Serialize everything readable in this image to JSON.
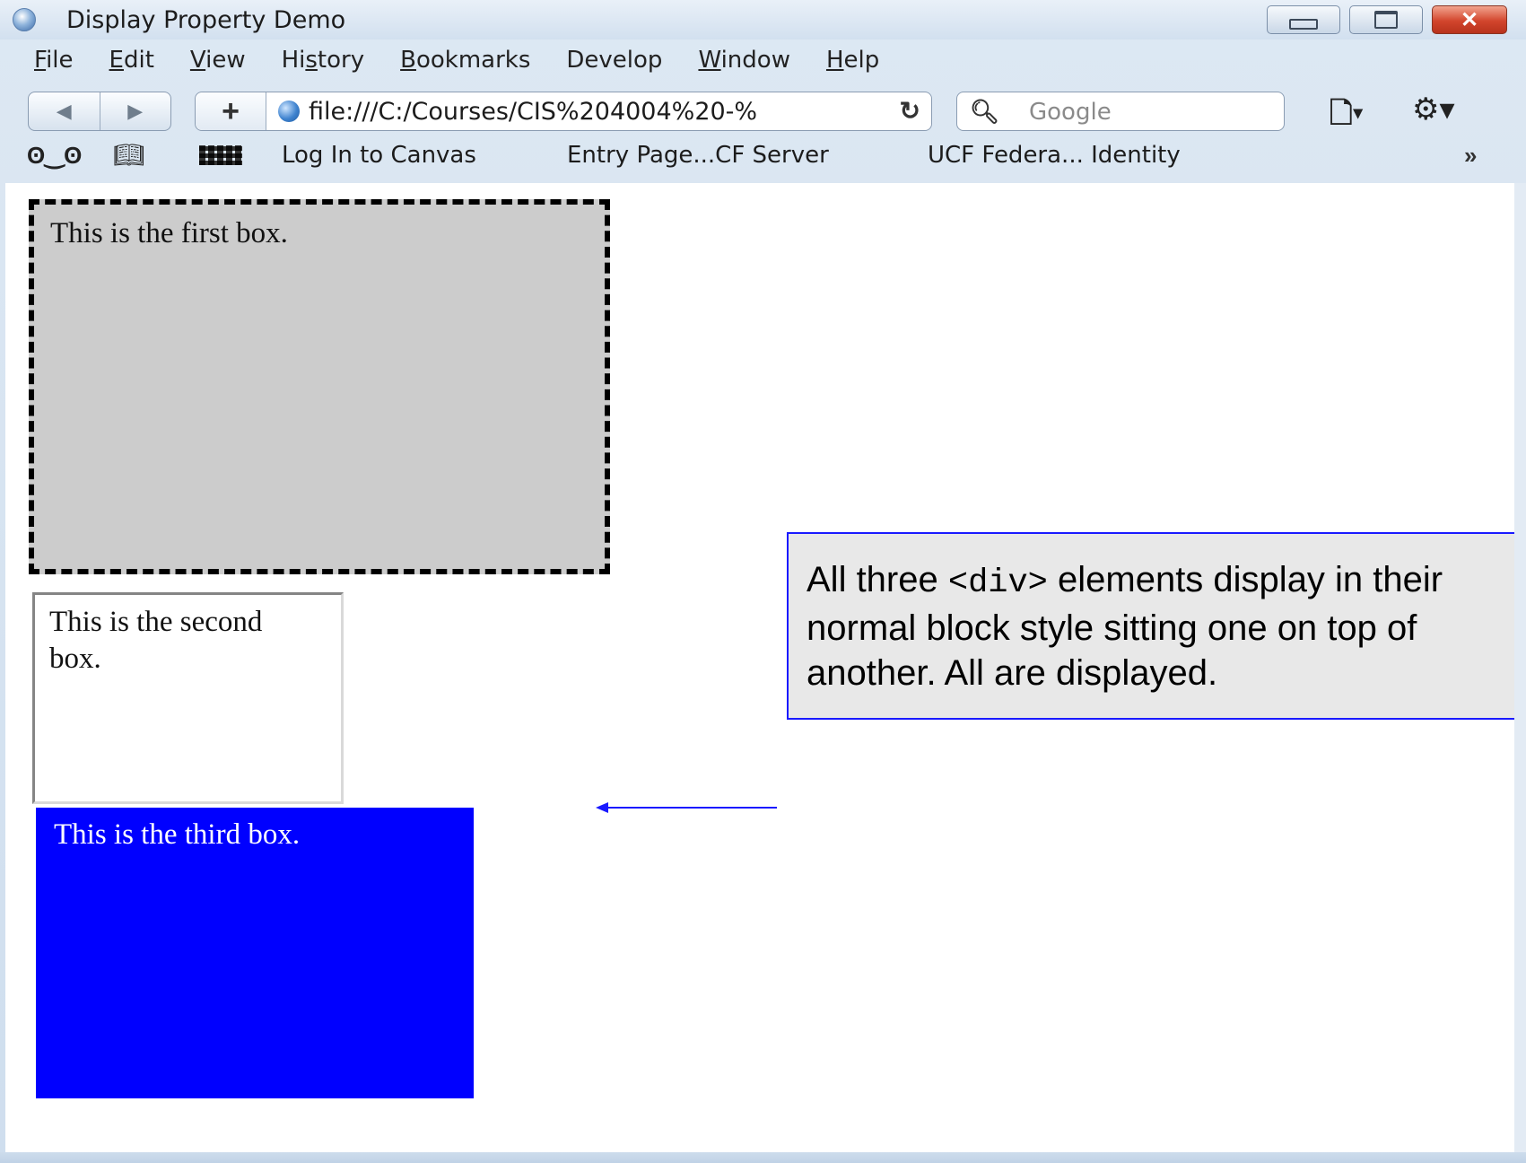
{
  "window": {
    "title": "Display Property Demo"
  },
  "menu": [
    {
      "label": "File",
      "accel": "F",
      "rest": "ile"
    },
    {
      "label": "Edit",
      "accel": "E",
      "rest": "dit"
    },
    {
      "label": "View",
      "accel": "V",
      "rest": "iew"
    },
    {
      "label": "History",
      "pre": "Hi",
      "accel": "s",
      "rest": "tory"
    },
    {
      "label": "Bookmarks",
      "accel": "B",
      "rest": "ookmarks"
    },
    {
      "label": "Develop",
      "accel": "",
      "rest": "Develop"
    },
    {
      "label": "Window",
      "accel": "W",
      "rest": "indow"
    },
    {
      "label": "Help",
      "accel": "H",
      "rest": "elp"
    }
  ],
  "nav": {
    "url": "file:///C:/Courses/CIS%204004%20-%",
    "search_placeholder": "Google"
  },
  "bookmarks": [
    "Log In to Canvas",
    "Entry Page...CF Server",
    "UCF Federa... Identity"
  ],
  "boxes": {
    "first": "This is the first box.",
    "second": "This is the second box.",
    "third": "This is the third box."
  },
  "callout": {
    "pre": "All three ",
    "code": "<div>",
    "post": "  elements display in their normal block style sitting one on top of another.  All are displayed."
  },
  "colors": {
    "third_box": "#0000ff",
    "first_box": "#cccccc",
    "callout_border": "#1a1aff"
  }
}
